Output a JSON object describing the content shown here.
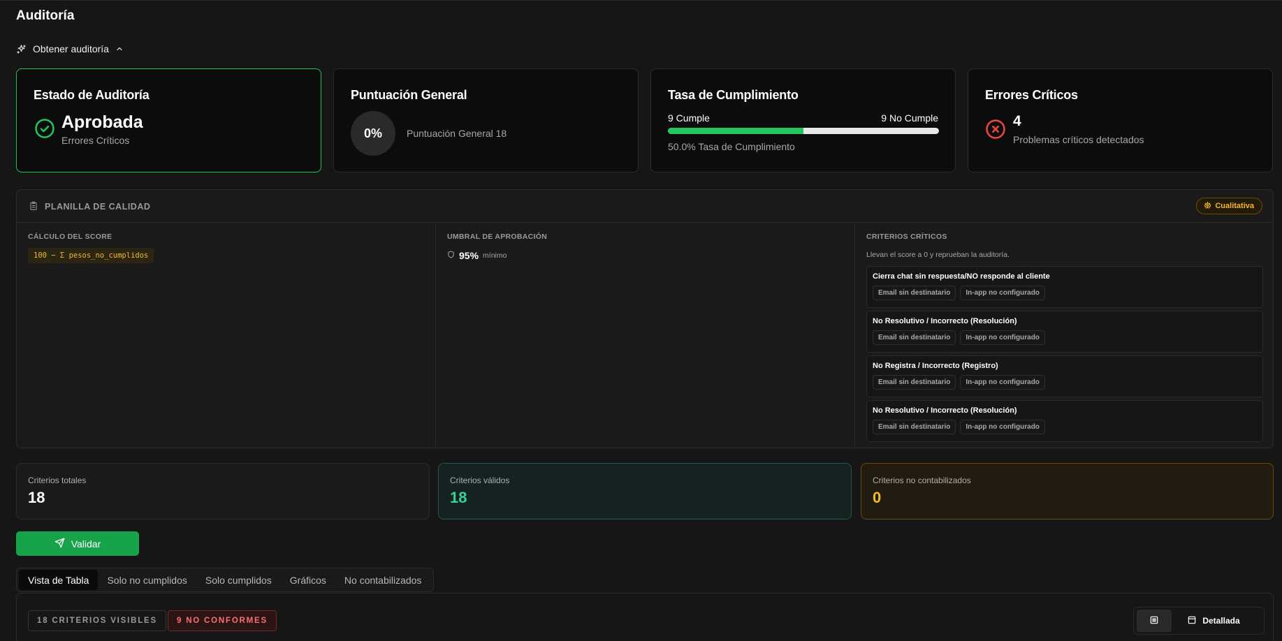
{
  "page": {
    "title": "Auditoría"
  },
  "obtener": {
    "label": "Obtener auditoría"
  },
  "cards": {
    "estado": {
      "title": "Estado de Auditoría",
      "value": "Aprobada",
      "subtitle": "Errores Críticos"
    },
    "puntuacion": {
      "title": "Puntuación General",
      "value": "0%",
      "label": "Puntuación General 18"
    },
    "tasa": {
      "title": "Tasa de Cumplimiento",
      "cumple": "9 Cumple",
      "no_cumple": "9 No Cumple",
      "fraction": 0.5,
      "label": "50.0% Tasa de Cumplimiento"
    },
    "errores": {
      "title": "Errores Críticos",
      "value": "4",
      "subtitle": "Problemas críticos detectados"
    }
  },
  "planilla": {
    "title": "PLANILLA DE CALIDAD",
    "badge": "Cualitativa",
    "calculo": {
      "label": "CÁLCULO DEL SCORE",
      "formula": "100 − Σ pesos_no_cumplidos"
    },
    "umbral": {
      "label": "UMBRAL DE APROBACIÓN",
      "value": "95%",
      "suffix": "mínimo"
    },
    "criticos": {
      "label": "CRITERIOS CRÍTICOS",
      "description": "Llevan el score a 0 y reprueban la auditoría.",
      "items": [
        {
          "name": "Cierra chat sin respuesta/NO responde al cliente",
          "tag1": "Email sin destinatario",
          "tag2": "In-app no configurado"
        },
        {
          "name": "No Resolutivo / Incorrecto (Resolución)",
          "tag1": "Email sin destinatario",
          "tag2": "In-app no configurado"
        },
        {
          "name": "No Registra / Incorrecto (Registro)",
          "tag1": "Email sin destinatario",
          "tag2": "In-app no configurado"
        },
        {
          "name": "No Resolutivo / Incorrecto (Resolución)",
          "tag1": "Email sin destinatario",
          "tag2": "In-app no configurado"
        }
      ]
    }
  },
  "stats": {
    "totales": {
      "label": "Criterios totales",
      "value": "18"
    },
    "validos": {
      "label": "Criterios válidos",
      "value": "18"
    },
    "no_contabilizados": {
      "label": "Criterios no contabilizados",
      "value": "0"
    }
  },
  "actions": {
    "validar": "Validar"
  },
  "tabs": [
    "Vista de Tabla",
    "Solo no cumplidos",
    "Solo cumplidos",
    "Gráficos",
    "No contabilizados"
  ],
  "filters": {
    "visibles": "18 CRITERIOS VISIBLES",
    "no_conformes": "9 NO CONFORMES"
  },
  "view": {
    "detallada": "Detallada"
  },
  "colors": {
    "accent_green": "#22c55e",
    "critical_red": "#ef4444",
    "warning_amber": "#f5b82e",
    "valid_teal": "#34d399"
  }
}
